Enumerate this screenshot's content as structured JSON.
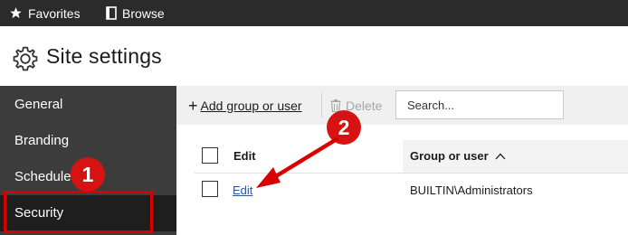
{
  "topbar": {
    "favorites_label": "Favorites",
    "browse_label": "Browse"
  },
  "header": {
    "title": "Site settings"
  },
  "sidebar": {
    "items": [
      {
        "label": "General"
      },
      {
        "label": "Branding"
      },
      {
        "label": "Schedule"
      },
      {
        "label": "Security",
        "selected": true
      }
    ]
  },
  "toolbar": {
    "add_icon": "+",
    "add_label": "Add group or user",
    "delete_label": "Delete",
    "search_placeholder": "Search..."
  },
  "table": {
    "columns": [
      "Edit",
      "Group or user"
    ],
    "sort_indicator": "^",
    "rows": [
      {
        "edit": "Edit",
        "group": "BUILTIN\\Administrators"
      }
    ]
  },
  "annotations": {
    "badge1": "1",
    "badge2": "2",
    "accent_color": "#d90000"
  },
  "icons": [
    "star-icon",
    "browse-icon",
    "gear-icon",
    "plus-icon",
    "trash-icon",
    "sort-up-icon"
  ]
}
